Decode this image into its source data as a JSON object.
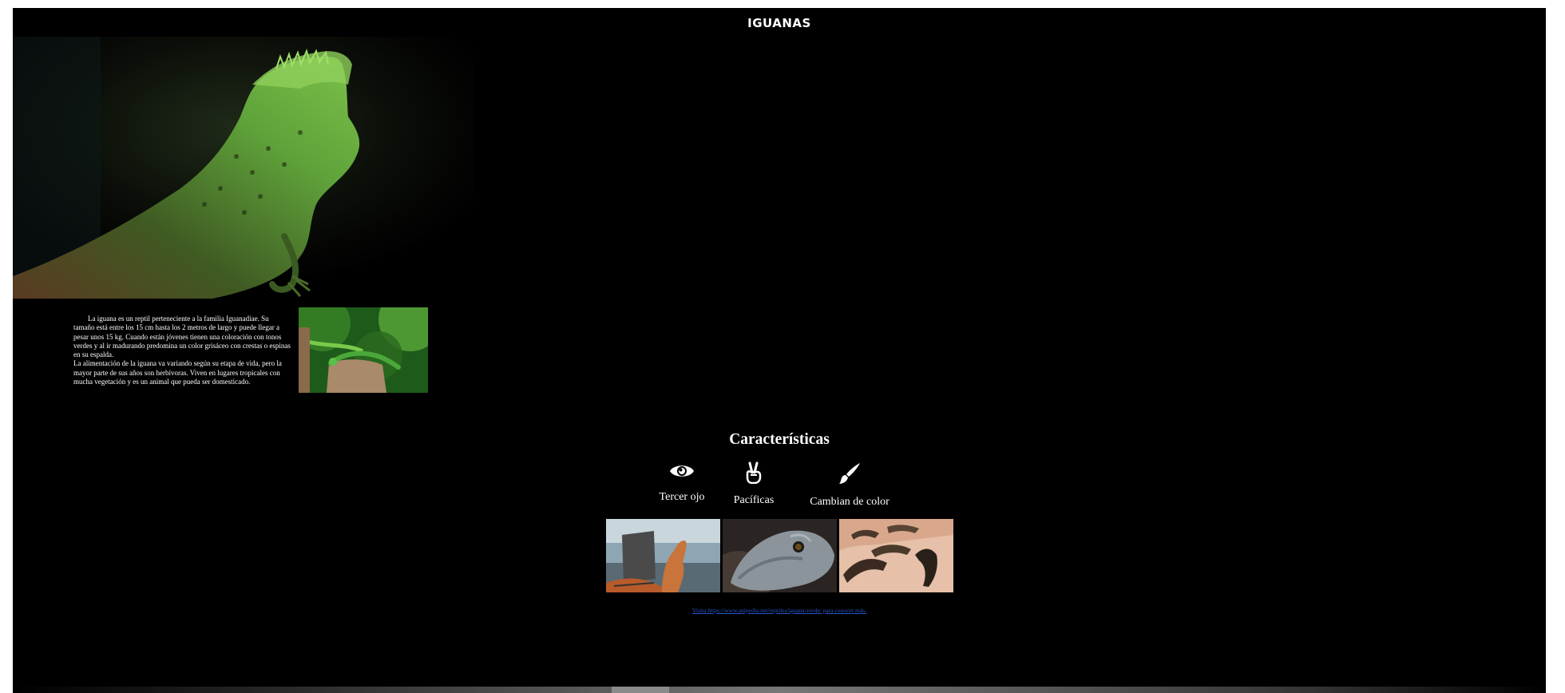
{
  "page": {
    "title": "IGUANAS"
  },
  "intro": {
    "paragraph1": "La iguana es un reptil perteneciente a la familia Iguanadiae. Su tamaño está entre los 15 cm hasta los 2 metros de largo y puede llegar a pesar unos 15 kg. Cuando están jóvenes tienen una coloración con tonos verdes y al ir madurando predomina un color grisáceo con crestas o espinas en su espalda.",
    "paragraph2": "La alimentación de la iguana va variando según su etapa de vida, pero la mayor parte de sus años son herbívoras. Viven en lugares tropicales con mucha vegetación y es un animal que pueda ser domesticado."
  },
  "characteristics": {
    "title": "Características",
    "items": [
      {
        "icon": "eye-icon",
        "label": "Tercer ojo"
      },
      {
        "icon": "peace-hand-icon",
        "label": "Pacíficas"
      },
      {
        "icon": "paintbrush-icon",
        "label": "Cambian de color"
      }
    ]
  },
  "footer": {
    "link_text": "Visita https://www.anipedia.net/reptiles/iguana-verde/ para conocer más."
  },
  "colors": {
    "background": "#000000",
    "text": "#ffffff",
    "link": "#2255cc"
  }
}
